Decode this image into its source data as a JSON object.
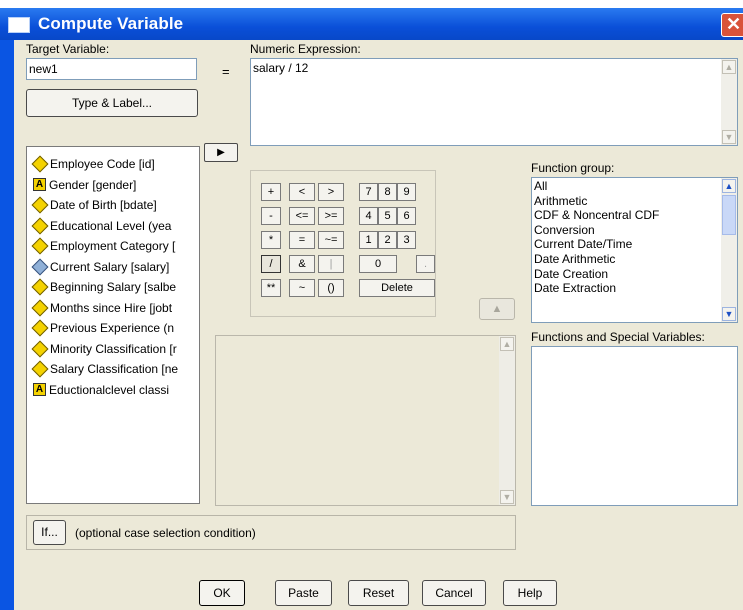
{
  "window": {
    "title": "Compute Variable"
  },
  "target": {
    "label": "Target Variable:",
    "value": "new1",
    "equals": "="
  },
  "type_label_button": "Type & Label...",
  "expression": {
    "label": "Numeric Expression:",
    "value": "salary / 12"
  },
  "variables": [
    {
      "label": "Employee Code [id]",
      "kind": "numeric"
    },
    {
      "label": "Gender [gender]",
      "kind": "string"
    },
    {
      "label": "Date of Birth [bdate]",
      "kind": "numeric"
    },
    {
      "label": "Educational Level (yea",
      "kind": "numeric"
    },
    {
      "label": "Employment Category [",
      "kind": "numeric"
    },
    {
      "label": "Current Salary [salary]",
      "kind": "scale",
      "selected": true
    },
    {
      "label": "Beginning Salary [salbe",
      "kind": "numeric"
    },
    {
      "label": "Months since Hire [jobt",
      "kind": "numeric"
    },
    {
      "label": "Previous Experience (n",
      "kind": "numeric"
    },
    {
      "label": "Minority Classification [r",
      "kind": "numeric"
    },
    {
      "label": "Salary Classification [ne",
      "kind": "numeric"
    },
    {
      "label": "Eductionalclevel classi",
      "kind": "string"
    }
  ],
  "keypad": {
    "ops": [
      "+",
      "<",
      ">",
      "-",
      "<=",
      ">=",
      "*",
      "=",
      "~=",
      "/",
      "&",
      "|",
      "**",
      "~",
      "()"
    ],
    "digits": [
      "7",
      "8",
      "9",
      "4",
      "5",
      "6",
      "1",
      "2",
      "3",
      "0",
      "."
    ],
    "delete": "Delete"
  },
  "function_group": {
    "label": "Function group:",
    "items": [
      "All",
      "Arithmetic",
      "CDF & Noncentral CDF",
      "Conversion",
      "Current Date/Time",
      "Date Arithmetic",
      "Date Creation",
      "Date Extraction"
    ]
  },
  "functions_label": "Functions and Special Variables:",
  "if_button": "If...",
  "if_text": "(optional case selection condition)",
  "buttons": {
    "ok": "OK",
    "paste": "Paste",
    "reset": "Reset",
    "cancel": "Cancel",
    "help": "Help"
  },
  "colors": {
    "titlebar": "#0a55e3",
    "dialog": "#ece9d8",
    "close": "#d9533a"
  }
}
